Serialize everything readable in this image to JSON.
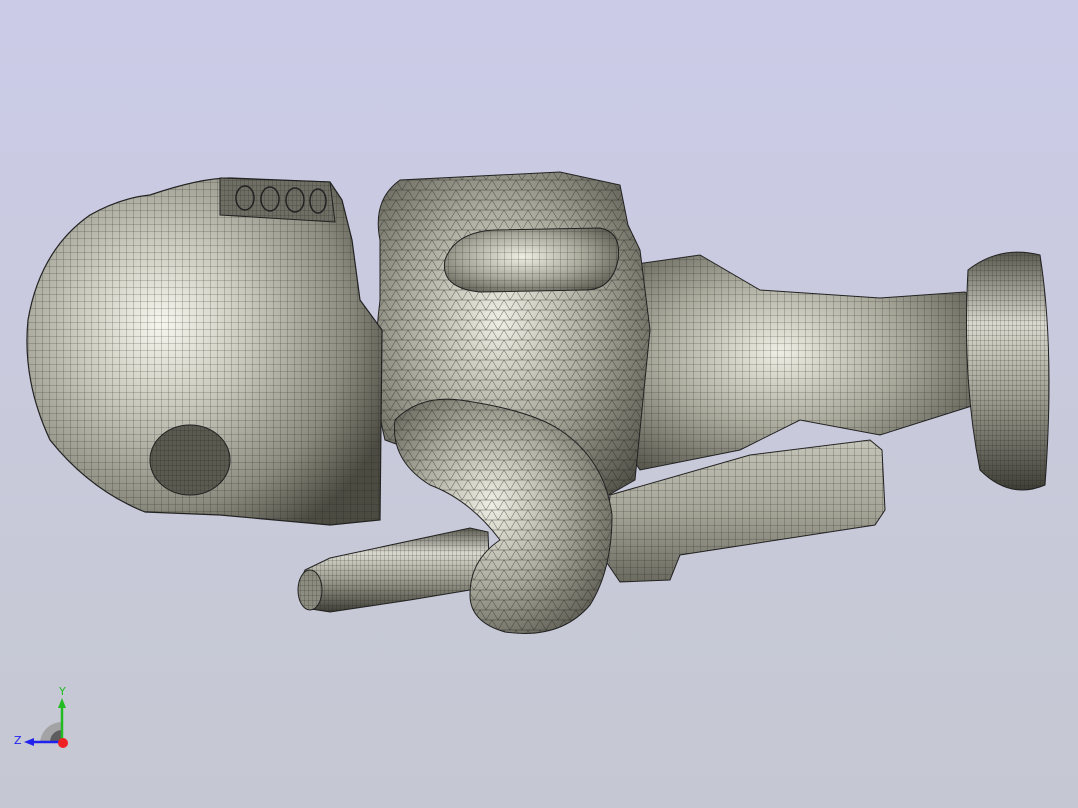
{
  "viewport": {
    "background_top": "#cbcbe8",
    "background_bottom": "#c5c8d2"
  },
  "model": {
    "render_style": "shaded-with-mesh-edges",
    "surface_color": "#b4b4a8",
    "highlight_color": "#f4f4ec",
    "shadow_color": "#3a3a32",
    "mesh_color": "#1e1e1c"
  },
  "triad": {
    "y_label": "Y",
    "z_label": "Z",
    "y_color": "#22bb22",
    "z_color": "#2222ee",
    "x_color": "#ee2222"
  }
}
